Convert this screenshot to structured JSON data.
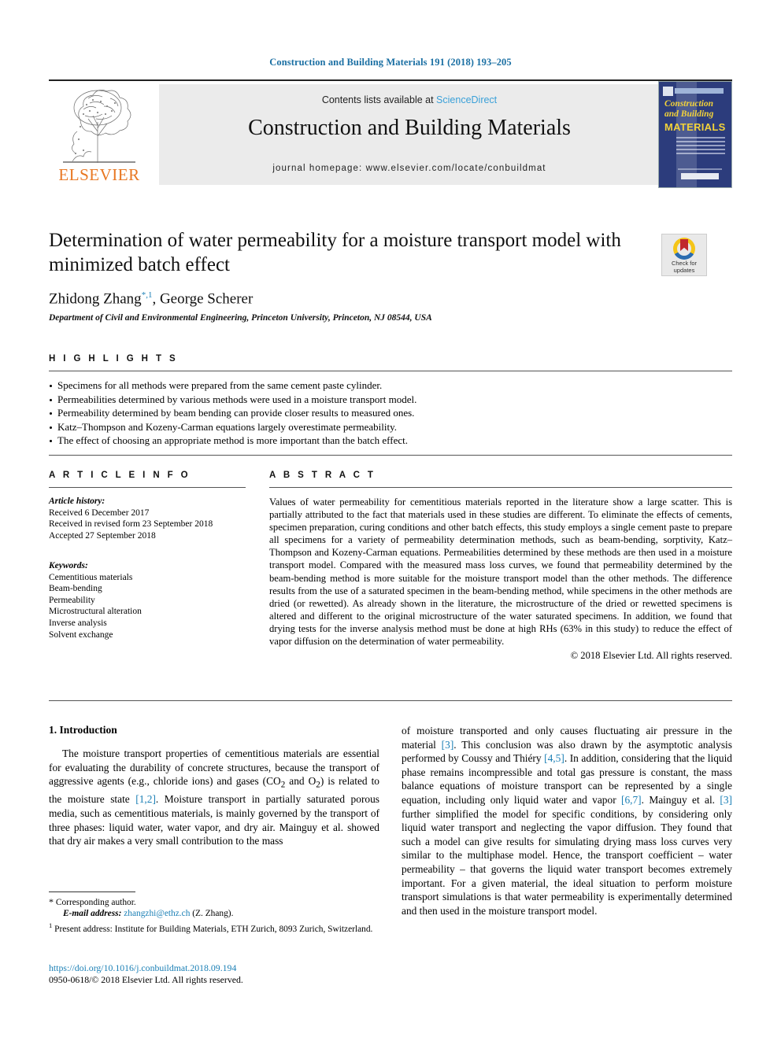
{
  "running_head": "Construction and Building Materials 191 (2018) 193–205",
  "masthead": {
    "publisher_name": "ELSEVIER",
    "contents_prefix": "Contents lists available at ",
    "sciencedirect": "ScienceDirect",
    "journal_title": "Construction and Building Materials",
    "homepage": "journal homepage: www.elsevier.com/locate/conbuildmat",
    "cover": {
      "line1": "Construction",
      "line2": "and Building",
      "line3": "MATERIALS"
    }
  },
  "article": {
    "title": "Determination of water permeability for a moisture transport model with minimized batch effect",
    "authors": "Zhidong Zhang",
    "author_marks": "*,1",
    "authors_rest": ", George Scherer",
    "affiliation": "Department of Civil and Environmental Engineering, Princeton University, Princeton, NJ 08544, USA",
    "crossmark_label_1": "Check for",
    "crossmark_label_2": "updates"
  },
  "highlights": {
    "heading": "H I G H L I G H T S",
    "items": [
      "Specimens for all methods were prepared from the same cement paste cylinder.",
      "Permeabilities determined by various methods were used in a moisture transport model.",
      "Permeability determined by beam bending can provide closer results to measured ones.",
      "Katz–Thompson and Kozeny-Carman equations largely overestimate permeability.",
      "The effect of choosing an appropriate method is more important than the batch effect."
    ]
  },
  "article_info": {
    "heading": "A R T I C L E  I N F O",
    "history_label": "Article history:",
    "history": [
      "Received 6 December 2017",
      "Received in revised form 23 September 2018",
      "Accepted 27 September 2018"
    ],
    "keywords_label": "Keywords:",
    "keywords": [
      "Cementitious materials",
      "Beam-bending",
      "Permeability",
      "Microstructural alteration",
      "Inverse analysis",
      "Solvent exchange"
    ]
  },
  "abstract": {
    "heading": "A B S T R A C T",
    "text": "Values of water permeability for cementitious materials reported in the literature show a large scatter. This is partially attributed to the fact that materials used in these studies are different. To eliminate the effects of cements, specimen preparation, curing conditions and other batch effects, this study employs a single cement paste to prepare all specimens for a variety of permeability determination methods, such as beam-bending, sorptivity, Katz–Thompson and Kozeny-Carman equations. Permeabilities determined by these methods are then used in a moisture transport model. Compared with the measured mass loss curves, we found that permeability determined by the beam-bending method is more suitable for the moisture transport model than the other methods. The difference results from the use of a saturated specimen in the beam-bending method, while specimens in the other methods are dried (or rewetted). As already shown in the literature, the microstructure of the dried or rewetted specimens is altered and different to the original microstructure of the water saturated specimens. In addition, we found that drying tests for the inverse analysis method must be done at high RHs (63% in this study) to reduce the effect of vapor diffusion on the determination of water permeability.",
    "copyright": "© 2018 Elsevier Ltd. All rights reserved."
  },
  "introduction": {
    "heading": "1. Introduction",
    "left_paragraph_a": "The moisture transport properties of cementitious materials are essential for evaluating the durability of concrete structures, because the transport of aggressive agents (e.g., chloride ions) and gases (CO",
    "left_paragraph_b": " and O",
    "left_paragraph_c": ") is related to the moisture state ",
    "left_ref_1": "[1,2]",
    "left_paragraph_d": ". Moisture transport in partially saturated porous media, such as cementitious materials, is mainly governed by the transport of three phases: liquid water, water vapor, and dry air. Mainguy et al. showed that dry air makes a very small contribution to the mass",
    "right_part_1": "of moisture transported and only causes fluctuating air pressure in the material ",
    "right_ref_1": "[3]",
    "right_part_2": ". This conclusion was also drawn by the asymptotic analysis performed by Coussy and Thiéry ",
    "right_ref_2": "[4,5]",
    "right_part_3": ". In addition, considering that the liquid phase remains incompressible and total gas pressure is constant, the mass balance equations of moisture transport can be represented by a single equation, including only liquid water and vapor ",
    "right_ref_3": "[6,7]",
    "right_part_4": ". Mainguy et al. ",
    "right_ref_4": "[3]",
    "right_part_5": " further simplified the model for specific conditions, by considering only liquid water transport and neglecting the vapor diffusion. They found that such a model can give results for simulating drying mass loss curves very similar to the multiphase model. Hence, the transport coefficient – water permeability – that governs the liquid water transport becomes extremely important. For a given material, the ideal situation to perform moisture transport simulations is that water permeability is experimentally determined and then used in the moisture transport model."
  },
  "footnotes": {
    "corresponding": "Corresponding author.",
    "email_label": "E-mail address:",
    "email": "zhangzhi@ethz.ch",
    "email_suffix": " (Z. Zhang).",
    "present_address": "Present address: Institute for Building Materials, ETH Zurich, 8093 Zurich, Switzerland.",
    "doi": "https://doi.org/10.1016/j.conbuildmat.2018.09.194",
    "issn_line": "0950-0618/© 2018 Elsevier Ltd. All rights reserved."
  },
  "colors": {
    "link": "#1a7fb5",
    "sciencedirect": "#3aa0d8",
    "elsevier_orange": "#e87722",
    "cover_blue": "#2c3c7c",
    "cover_yellow": "#f2d23a"
  }
}
